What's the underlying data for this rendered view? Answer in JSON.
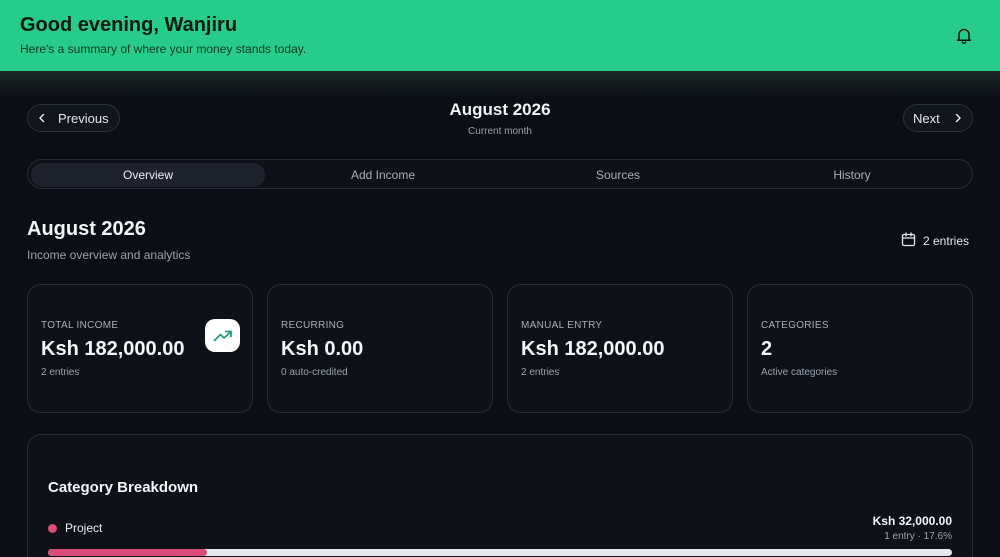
{
  "header": {
    "greeting": "Good evening, Wanjiru",
    "subtitle": "Here's a summary of where your money stands today.",
    "bell_icon": "bell-icon"
  },
  "month_nav": {
    "previous_label": "Previous",
    "next_label": "Next",
    "month": "August 2026",
    "month_caption": "Current month"
  },
  "tabs": [
    {
      "label": "Overview",
      "active": true
    },
    {
      "label": "Add Income",
      "active": false
    },
    {
      "label": "Sources",
      "active": false
    },
    {
      "label": "History",
      "active": false
    }
  ],
  "overview": {
    "title": "August 2026",
    "subtitle": "Income overview and analytics",
    "entries_label": "2 entries"
  },
  "stats": [
    {
      "label": "TOTAL INCOME",
      "value": "Ksh 182,000.00",
      "note": "2 entries",
      "icon": "trending-up-icon"
    },
    {
      "label": "RECURRING",
      "value": "Ksh 0.00",
      "note": "0 auto-credited"
    },
    {
      "label": "MANUAL ENTRY",
      "value": "Ksh 182,000.00",
      "note": "2 entries"
    },
    {
      "label": "CATEGORIES",
      "value": "2",
      "note": "Active categories"
    }
  ],
  "breakdown": {
    "title": "Category Breakdown",
    "items": [
      {
        "name": "Project",
        "amount": "Ksh 32,000.00",
        "meta": "1 entry · 17.6%",
        "percent": 17.6,
        "color": "#d94d78"
      }
    ]
  },
  "colors": {
    "accent": "#27cb8c",
    "background": "#0b0e14",
    "category_project": "#d94d78"
  }
}
